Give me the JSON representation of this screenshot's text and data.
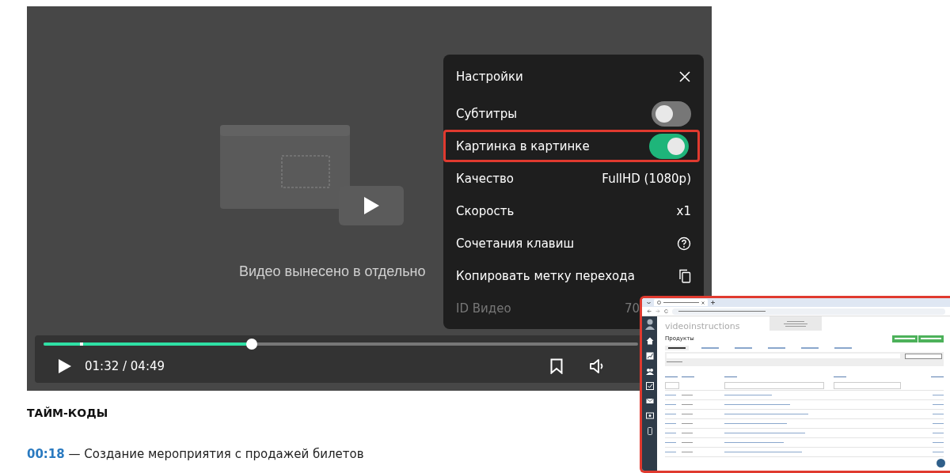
{
  "player": {
    "message": "Видео вынесено в отдельно",
    "progress": {
      "level": 0.32
    },
    "time": "01:32 / 04:49"
  },
  "settings": {
    "title": "Настройки",
    "rows": [
      {
        "kind": "toggle",
        "label": "Субтитры",
        "on": false,
        "highlighted": false
      },
      {
        "kind": "toggle",
        "label": "Картинка в картинке",
        "on": true,
        "highlighted": true
      },
      {
        "kind": "value",
        "label": "Качество",
        "value": "FullHD (1080p)"
      },
      {
        "kind": "value",
        "label": "Скорость",
        "value": "x1"
      },
      {
        "kind": "help",
        "label": "Сочетания клавиш"
      },
      {
        "kind": "copy",
        "label": "Копировать метку перехода"
      },
      {
        "kind": "info",
        "label": "ID Видео",
        "value": "70"
      }
    ]
  },
  "timecodes": {
    "heading": "ТАЙМ-КОДЫ",
    "items": [
      {
        "time": "00:18",
        "text": " — Создание мероприятия с продажей билетов"
      }
    ]
  },
  "pip": {
    "brand": "videoinstructions",
    "title": "Продукты",
    "tabs": [
      {
        "selected": true
      },
      {
        "selected": false
      },
      {
        "selected": false
      },
      {
        "selected": false
      },
      {
        "selected": false
      },
      {
        "selected": false
      }
    ]
  }
}
